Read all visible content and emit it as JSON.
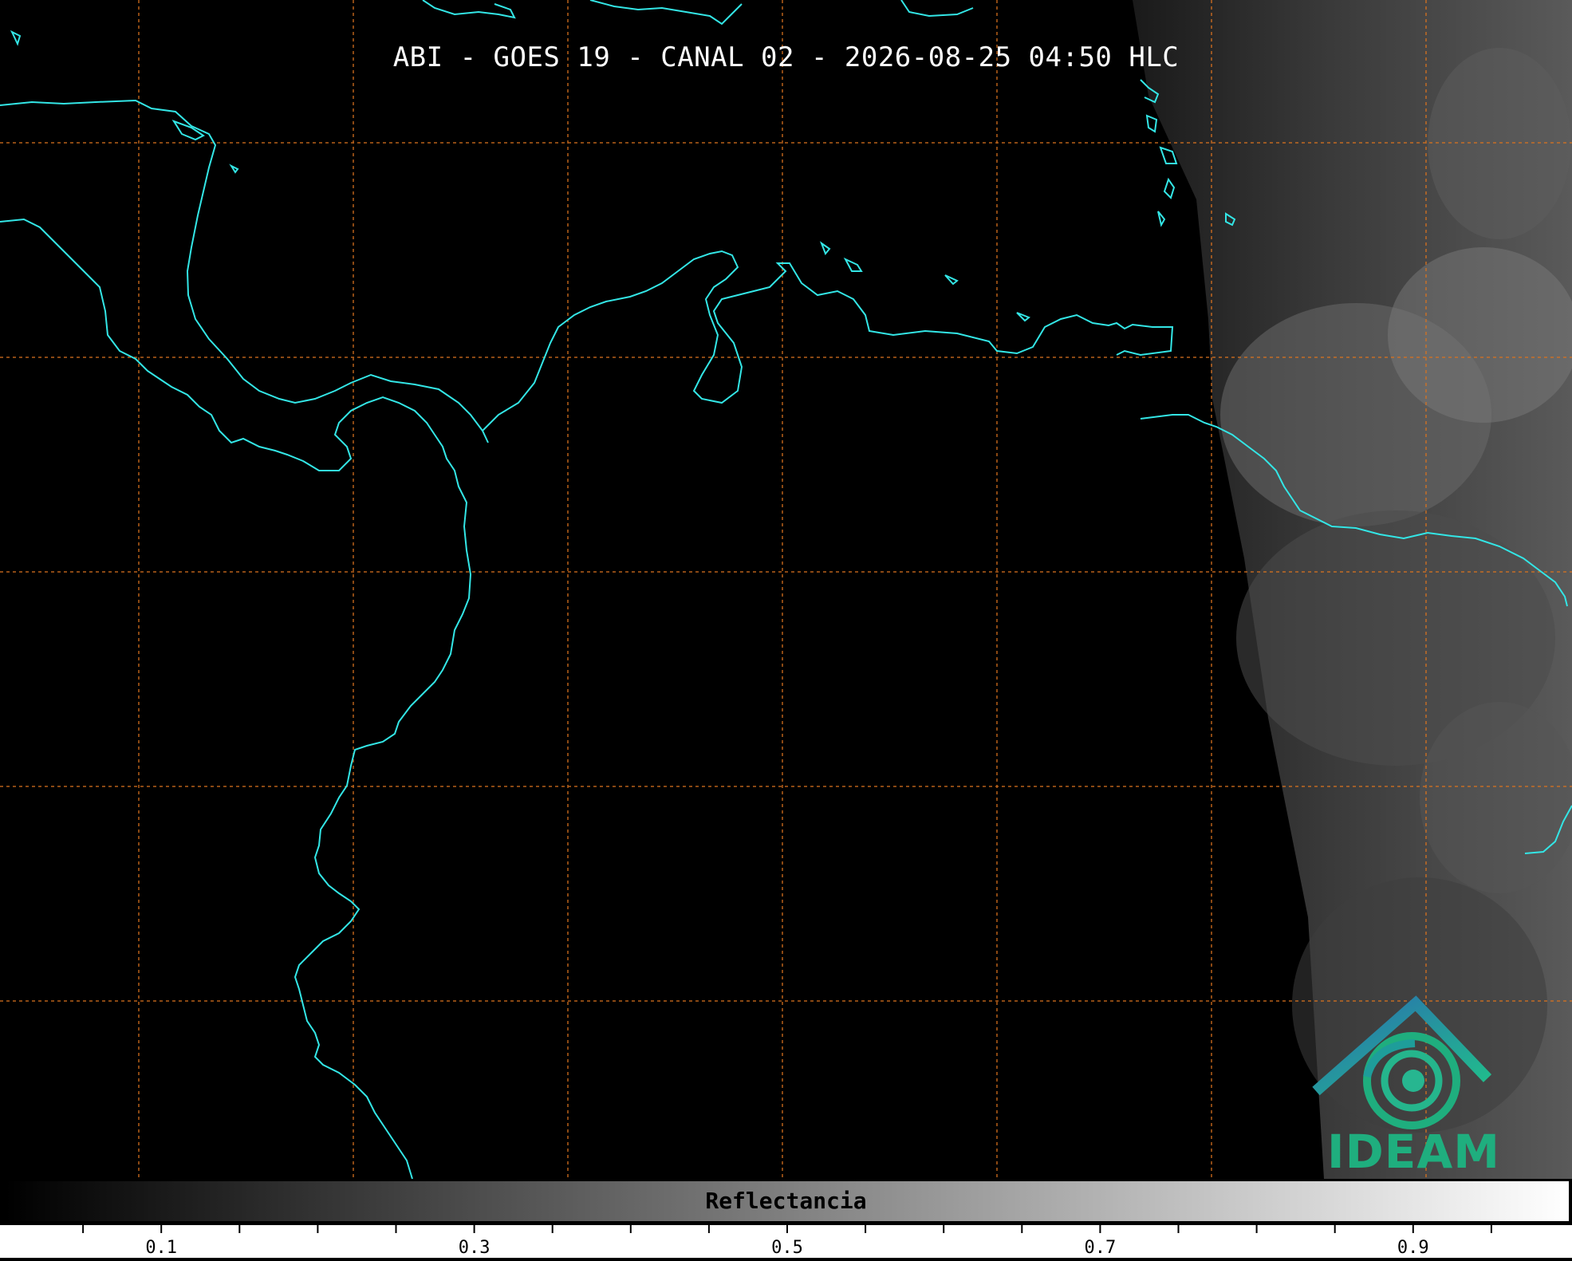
{
  "title": "ABI - GOES 19 - CANAL 02 - 2026-08-25 04:50 HLC",
  "logo": {
    "text": "IDEAM"
  },
  "colorbar": {
    "label": "Reflectancia",
    "range": [
      0,
      1
    ],
    "ticks": [
      "0.1",
      "0.3",
      "0.5",
      "0.7",
      "0.9"
    ]
  },
  "colors": {
    "coastline": "#33e6e6",
    "grid": "#d9731f",
    "background": "#000000"
  }
}
